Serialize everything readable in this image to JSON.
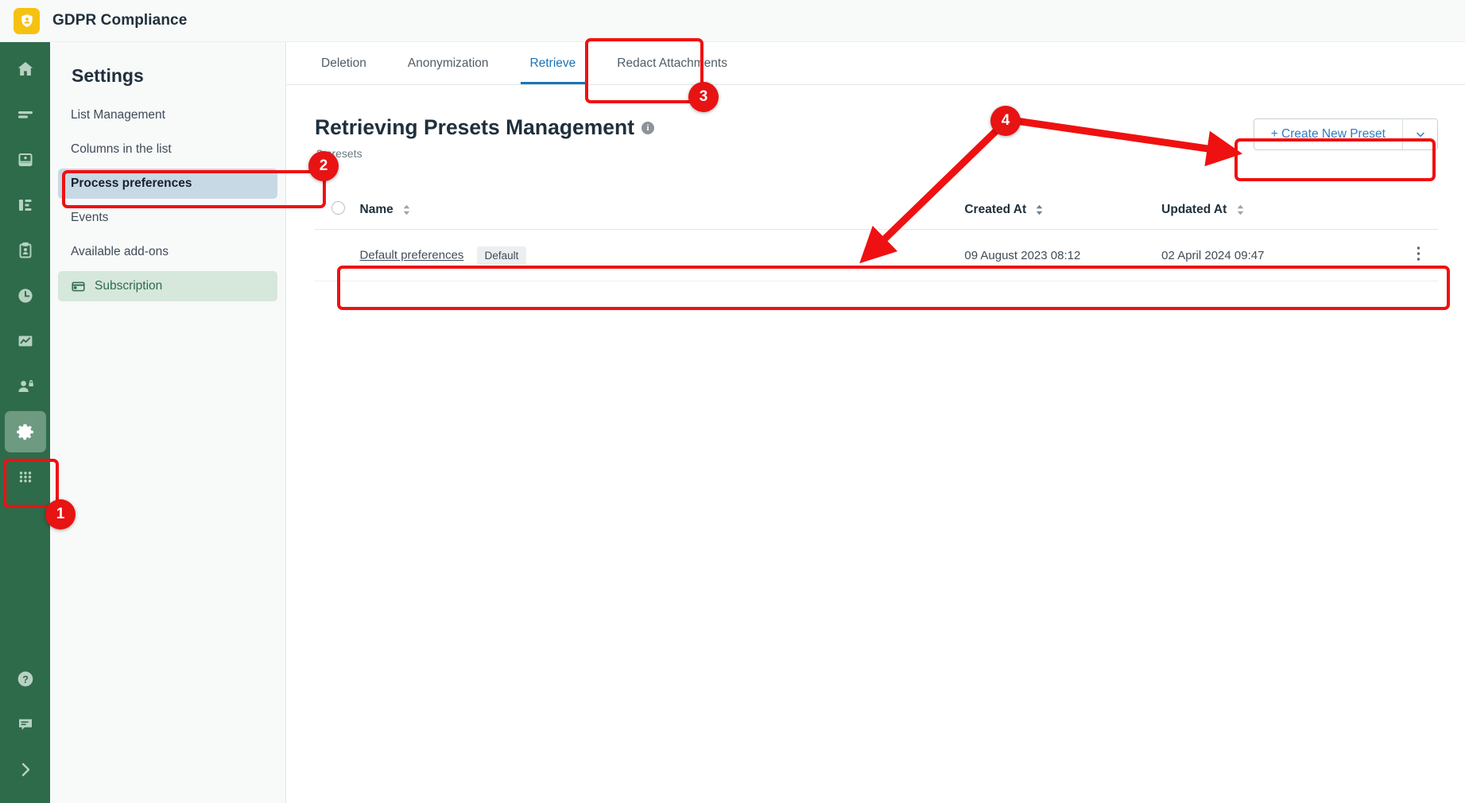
{
  "app": {
    "title": "GDPR Compliance",
    "logo_icon": "shield-person-icon"
  },
  "rail": {
    "items": [
      {
        "name": "home-icon",
        "label": "Home",
        "active": false
      },
      {
        "name": "list-icon",
        "label": "Lists",
        "active": false
      },
      {
        "name": "database-icon",
        "label": "Data",
        "active": false
      },
      {
        "name": "flow-icon",
        "label": "Workflow",
        "active": false
      },
      {
        "name": "clipboard-icon",
        "label": "Requests",
        "active": false
      },
      {
        "name": "clock-icon",
        "label": "History",
        "active": false
      },
      {
        "name": "chart-icon",
        "label": "Reports",
        "active": false
      },
      {
        "name": "user-lock-icon",
        "label": "Privacy",
        "active": false
      },
      {
        "name": "gear-icon",
        "label": "Settings",
        "active": true
      },
      {
        "name": "apps-grid-icon",
        "label": "Apps",
        "active": false
      }
    ],
    "bottom_items": [
      {
        "name": "help-icon",
        "label": "Help"
      },
      {
        "name": "feedback-icon",
        "label": "Feedback"
      },
      {
        "name": "expand-chevron-icon",
        "label": "Expand"
      }
    ]
  },
  "settings": {
    "heading": "Settings",
    "items": [
      {
        "label": "List Management",
        "selected": false,
        "icon": null
      },
      {
        "label": "Columns in the list",
        "selected": false,
        "icon": null
      },
      {
        "label": "Process preferences",
        "selected": true,
        "icon": null
      },
      {
        "label": "Events",
        "selected": false,
        "icon": null
      },
      {
        "label": "Available add-ons",
        "selected": false,
        "icon": null
      },
      {
        "label": "Subscription",
        "selected": false,
        "icon": "credit-card-icon"
      }
    ]
  },
  "tabs": [
    {
      "label": "Deletion",
      "active": false
    },
    {
      "label": "Anonymization",
      "active": false
    },
    {
      "label": "Retrieve",
      "active": true
    },
    {
      "label": "Redact Attachments",
      "active": false
    }
  ],
  "page": {
    "title": "Retrieving Presets Management",
    "info_icon": "info-icon",
    "info_glyph": "i",
    "preset_count": "2 presets"
  },
  "toolbar": {
    "create_label": "+ Create New Preset",
    "caret_icon": "chevron-down-icon"
  },
  "table": {
    "columns": [
      {
        "label": "Name",
        "sort": "inactive"
      },
      {
        "label": "Created At",
        "sort": "active"
      },
      {
        "label": "Updated At",
        "sort": "inactive"
      }
    ],
    "rows": [
      {
        "name": "Default preferences",
        "badge": "Default",
        "created_at": "09 August 2023 08:12",
        "updated_at": "02 April 2024 09:47",
        "menu_icon": "kebab-menu-icon"
      }
    ]
  },
  "annotations": {
    "accent": "#ef1111",
    "markers": [
      {
        "number": "1",
        "target": "settings-rail-icon"
      },
      {
        "number": "2",
        "target": "process-preferences-nav-item"
      },
      {
        "number": "3",
        "target": "retrieve-tab"
      },
      {
        "number": "4",
        "target": "create-new-preset-button"
      }
    ]
  }
}
